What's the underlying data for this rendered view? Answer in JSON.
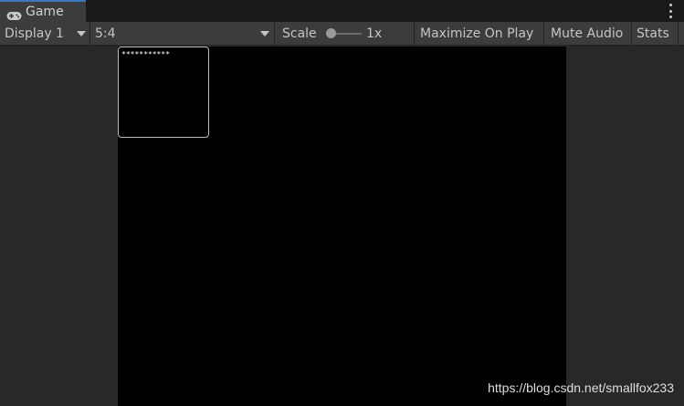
{
  "window": {
    "tab_label": "Game",
    "tab_icon": "gamepad-icon",
    "menu_icon": "kebab-menu-icon"
  },
  "toolbar": {
    "display_label": "Display 1",
    "aspect_label": "5:4",
    "scale_label": "Scale",
    "scale_value": "1x",
    "scale_level": 0,
    "maximize_label": "Maximize On Play",
    "mute_label": "Mute Audio",
    "stats_label": "Stats"
  },
  "game_view": {
    "ui_box_text": "***********",
    "background": "#000000"
  },
  "watermark": "https://blog.csdn.net/smallfox233",
  "colors": {
    "tab_accent": "#3a79bb",
    "toolbar_bg": "#3c3c3c",
    "panel_bg": "#282828"
  }
}
